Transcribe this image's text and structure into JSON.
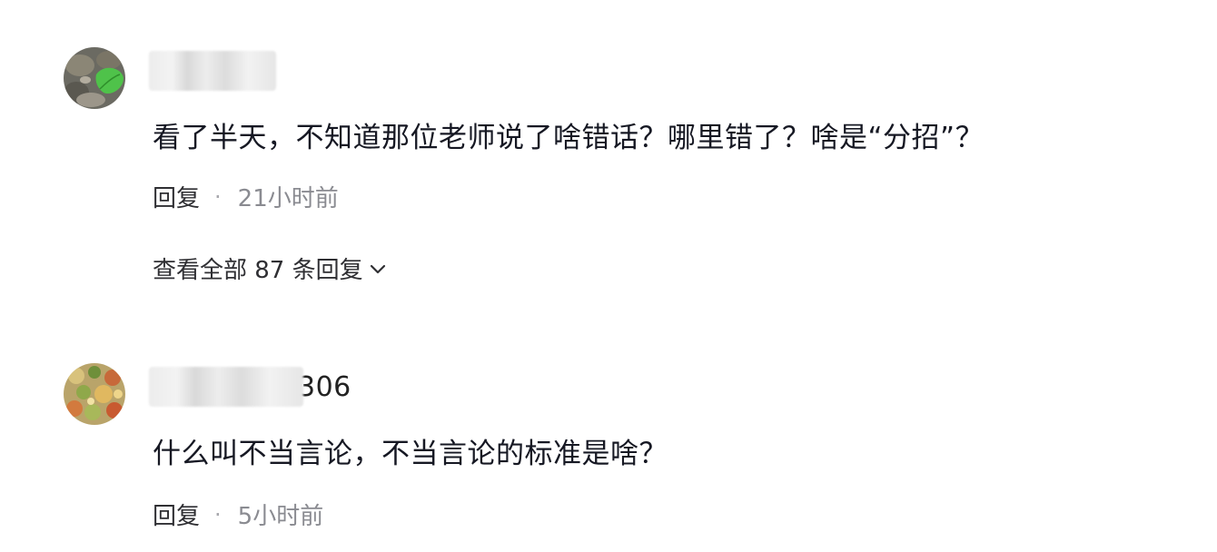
{
  "comments": [
    {
      "username_suffix": "",
      "text": "看了半天，不知道那位老师说了啥错话？哪里错了？啥是“分招”？",
      "reply_label": "回复",
      "separator": "·",
      "time": "21小时前",
      "view_replies": "查看全部 87 条回复",
      "avatar_icon": "leaf-photo-avatar",
      "colors": {
        "avatar_bg": "#6b6a62",
        "leaf": "#4fc24a"
      }
    },
    {
      "username_suffix": "306",
      "text": "什么叫不当言论，不当言论的标准是啥？",
      "reply_label": "回复",
      "separator": "·",
      "time": "5小时前",
      "avatar_icon": "food-photo-avatar",
      "colors": {
        "avatar_bg": "#b9a46a"
      }
    }
  ],
  "icons": {
    "expand": "chevron-down-icon"
  },
  "colors": {
    "text_primary": "#161823",
    "text_secondary": "#8a8b91",
    "background": "#ffffff"
  }
}
